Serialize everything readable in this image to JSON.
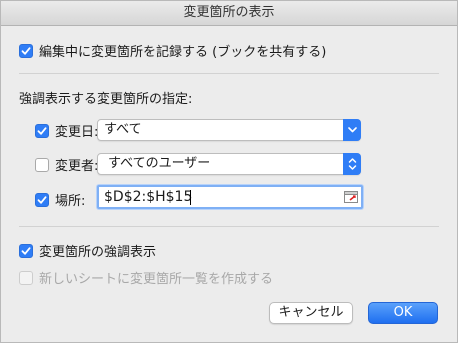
{
  "window": {
    "title": "変更箇所の表示"
  },
  "track_changes": {
    "label": "編集中に変更箇所を記録する (ブックを共有する)",
    "checked": true
  },
  "highlight_section": {
    "heading": "強調表示する変更箇所の指定:"
  },
  "when": {
    "label": "変更日:",
    "checked": true,
    "value": "すべて"
  },
  "who": {
    "label": "変更者:",
    "checked": false,
    "value": "すべてのユーザー"
  },
  "where": {
    "label": "場所:",
    "checked": true,
    "value": "$D$2:$H$15"
  },
  "highlight_on_screen": {
    "label": "変更箇所の強調表示",
    "checked": true
  },
  "list_new_sheet": {
    "label": "新しいシートに変更箇所一覧を作成する",
    "checked": false,
    "enabled": false
  },
  "buttons": {
    "cancel_label": "キャンセル",
    "ok_label": "OK"
  },
  "colors": {
    "accent": "#2f7df6",
    "disabled_text": "#a8a8a8"
  }
}
